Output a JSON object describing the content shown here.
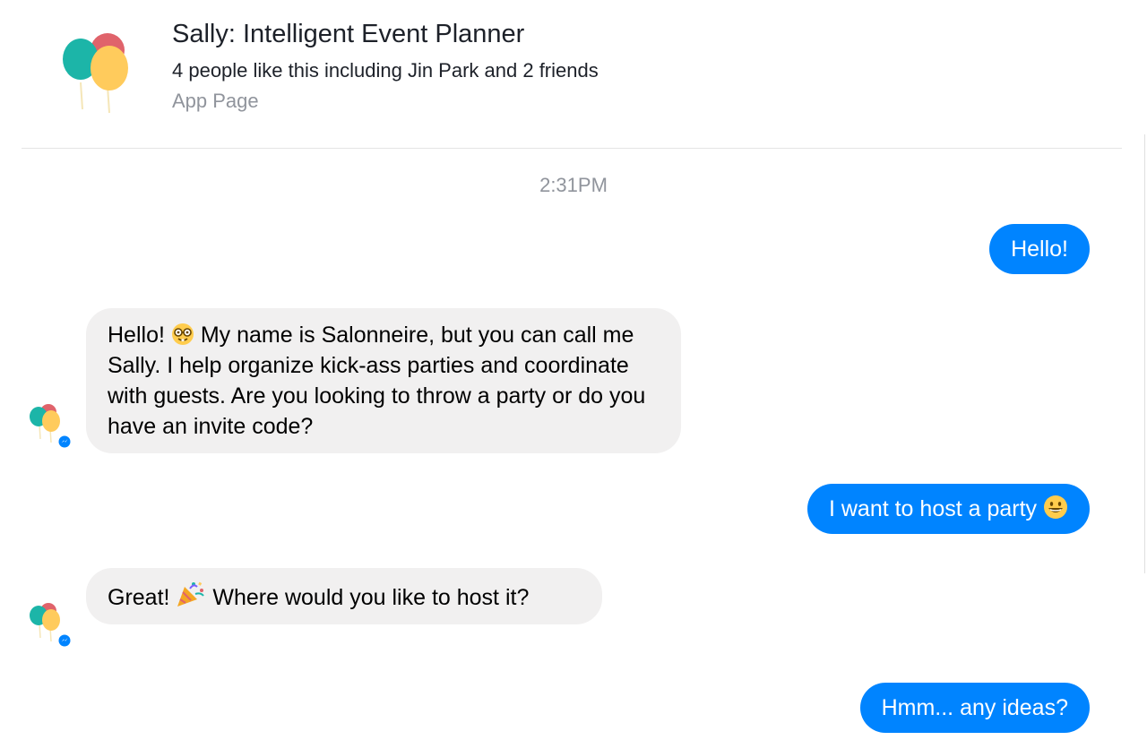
{
  "header": {
    "title": "Sally: Intelligent Event Planner",
    "likes": "4 people like this including Jin Park and 2 friends",
    "type": "App Page",
    "logo": "balloons-logo"
  },
  "conversation": {
    "timestamp": "2:31PM",
    "messages": [
      {
        "from": "user",
        "text": "Hello!"
      },
      {
        "from": "bot",
        "text_before": "Hello!",
        "emoji": "nerd-face-emoji",
        "text_after": "My name is Salonneire, but you can call me Sally. I help organize kick-ass parties and coordinate with guests. Are you looking to throw a party or do you have an invite code?"
      },
      {
        "from": "user",
        "text": "I want to host a party",
        "emoji": "grinning-face-emoji"
      },
      {
        "from": "bot",
        "text_before": "Great!",
        "emoji": "party-popper-emoji",
        "text_after": "Where would you like to host it?"
      },
      {
        "from": "user",
        "text": "Hmm... any ideas?"
      }
    ]
  },
  "colors": {
    "outgoing_bubble": "#0084ff",
    "incoming_bubble": "#f1f0f0",
    "secondary_text": "#90949c",
    "balloon_teal": "#1cb5a8",
    "balloon_red": "#e0636b",
    "balloon_yellow": "#ffcb5c",
    "messenger_badge": "#0084ff"
  }
}
